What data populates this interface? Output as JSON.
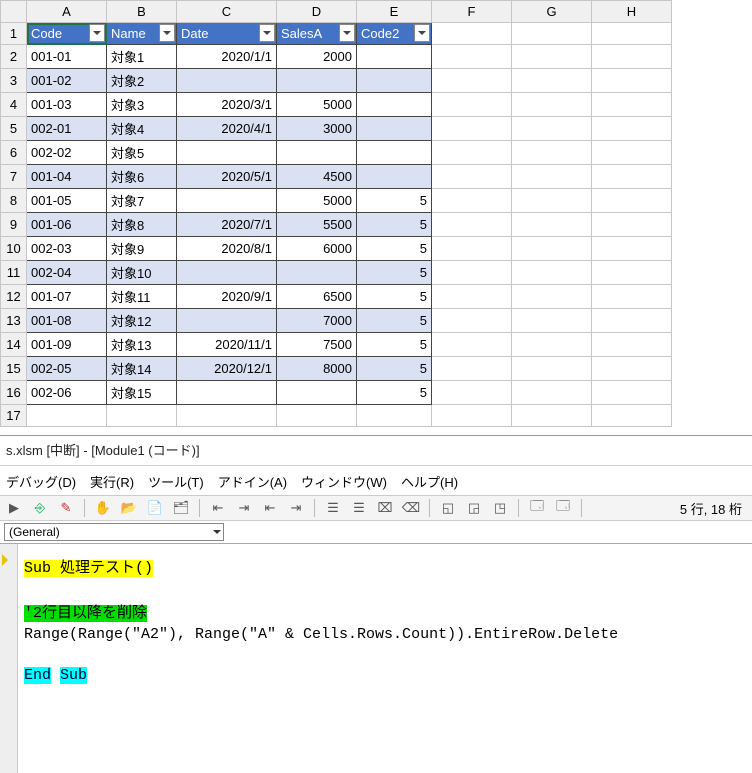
{
  "spreadsheet": {
    "colHeaders": [
      "A",
      "B",
      "C",
      "D",
      "E",
      "F",
      "G",
      "H"
    ],
    "rowHeaders": [
      "1",
      "2",
      "3",
      "4",
      "5",
      "6",
      "7",
      "8",
      "9",
      "10",
      "11",
      "12",
      "13",
      "14",
      "15",
      "16",
      "17"
    ],
    "tableHeaders": [
      "Code",
      "Name",
      "Date",
      "SalesA",
      "Code2"
    ],
    "rows": [
      {
        "code": "001-01",
        "name": "対象1",
        "date": "2020/1/1",
        "sales": "2000",
        "code2": ""
      },
      {
        "code": "001-02",
        "name": "対象2",
        "date": "",
        "sales": "",
        "code2": ""
      },
      {
        "code": "001-03",
        "name": "対象3",
        "date": "2020/3/1",
        "sales": "5000",
        "code2": ""
      },
      {
        "code": "002-01",
        "name": "対象4",
        "date": "2020/4/1",
        "sales": "3000",
        "code2": ""
      },
      {
        "code": "002-02",
        "name": "対象5",
        "date": "",
        "sales": "",
        "code2": ""
      },
      {
        "code": "001-04",
        "name": "対象6",
        "date": "2020/5/1",
        "sales": "4500",
        "code2": ""
      },
      {
        "code": "001-05",
        "name": "対象7",
        "date": "",
        "sales": "5000",
        "code2": "5"
      },
      {
        "code": "001-06",
        "name": "対象8",
        "date": "2020/7/1",
        "sales": "5500",
        "code2": "5"
      },
      {
        "code": "002-03",
        "name": "対象9",
        "date": "2020/8/1",
        "sales": "6000",
        "code2": "5"
      },
      {
        "code": "002-04",
        "name": "対象10",
        "date": "",
        "sales": "",
        "code2": "5"
      },
      {
        "code": "001-07",
        "name": "対象11",
        "date": "2020/9/1",
        "sales": "6500",
        "code2": "5"
      },
      {
        "code": "001-08",
        "name": "対象12",
        "date": "",
        "sales": "7000",
        "code2": "5"
      },
      {
        "code": "001-09",
        "name": "対象13",
        "date": "2020/11/1",
        "sales": "7500",
        "code2": "5"
      },
      {
        "code": "002-05",
        "name": "対象14",
        "date": "2020/12/1",
        "sales": "8000",
        "code2": "5"
      },
      {
        "code": "002-06",
        "name": "対象15",
        "date": "",
        "sales": "",
        "code2": "5"
      }
    ]
  },
  "vbe": {
    "title": "s.xlsm [中断] - [Module1 (コード)]",
    "menu": {
      "debug": "デバッグ(D)",
      "run": "実行(R)",
      "tools": "ツール(T)",
      "addins": "アドイン(A)",
      "window": "ウィンドウ(W)",
      "help": "ヘルプ(H)"
    },
    "pos": "5 行, 18 桁",
    "combo": "(General)",
    "code": {
      "subOpen": "Sub 処理テスト()",
      "comment": "'2行目以降を削除",
      "stmt": "Range(Range(\"A2\"), Range(\"A\" & Cells.Rows.Count)).EntireRow.Delete",
      "endKw": "End",
      "subKw": "Sub"
    }
  }
}
